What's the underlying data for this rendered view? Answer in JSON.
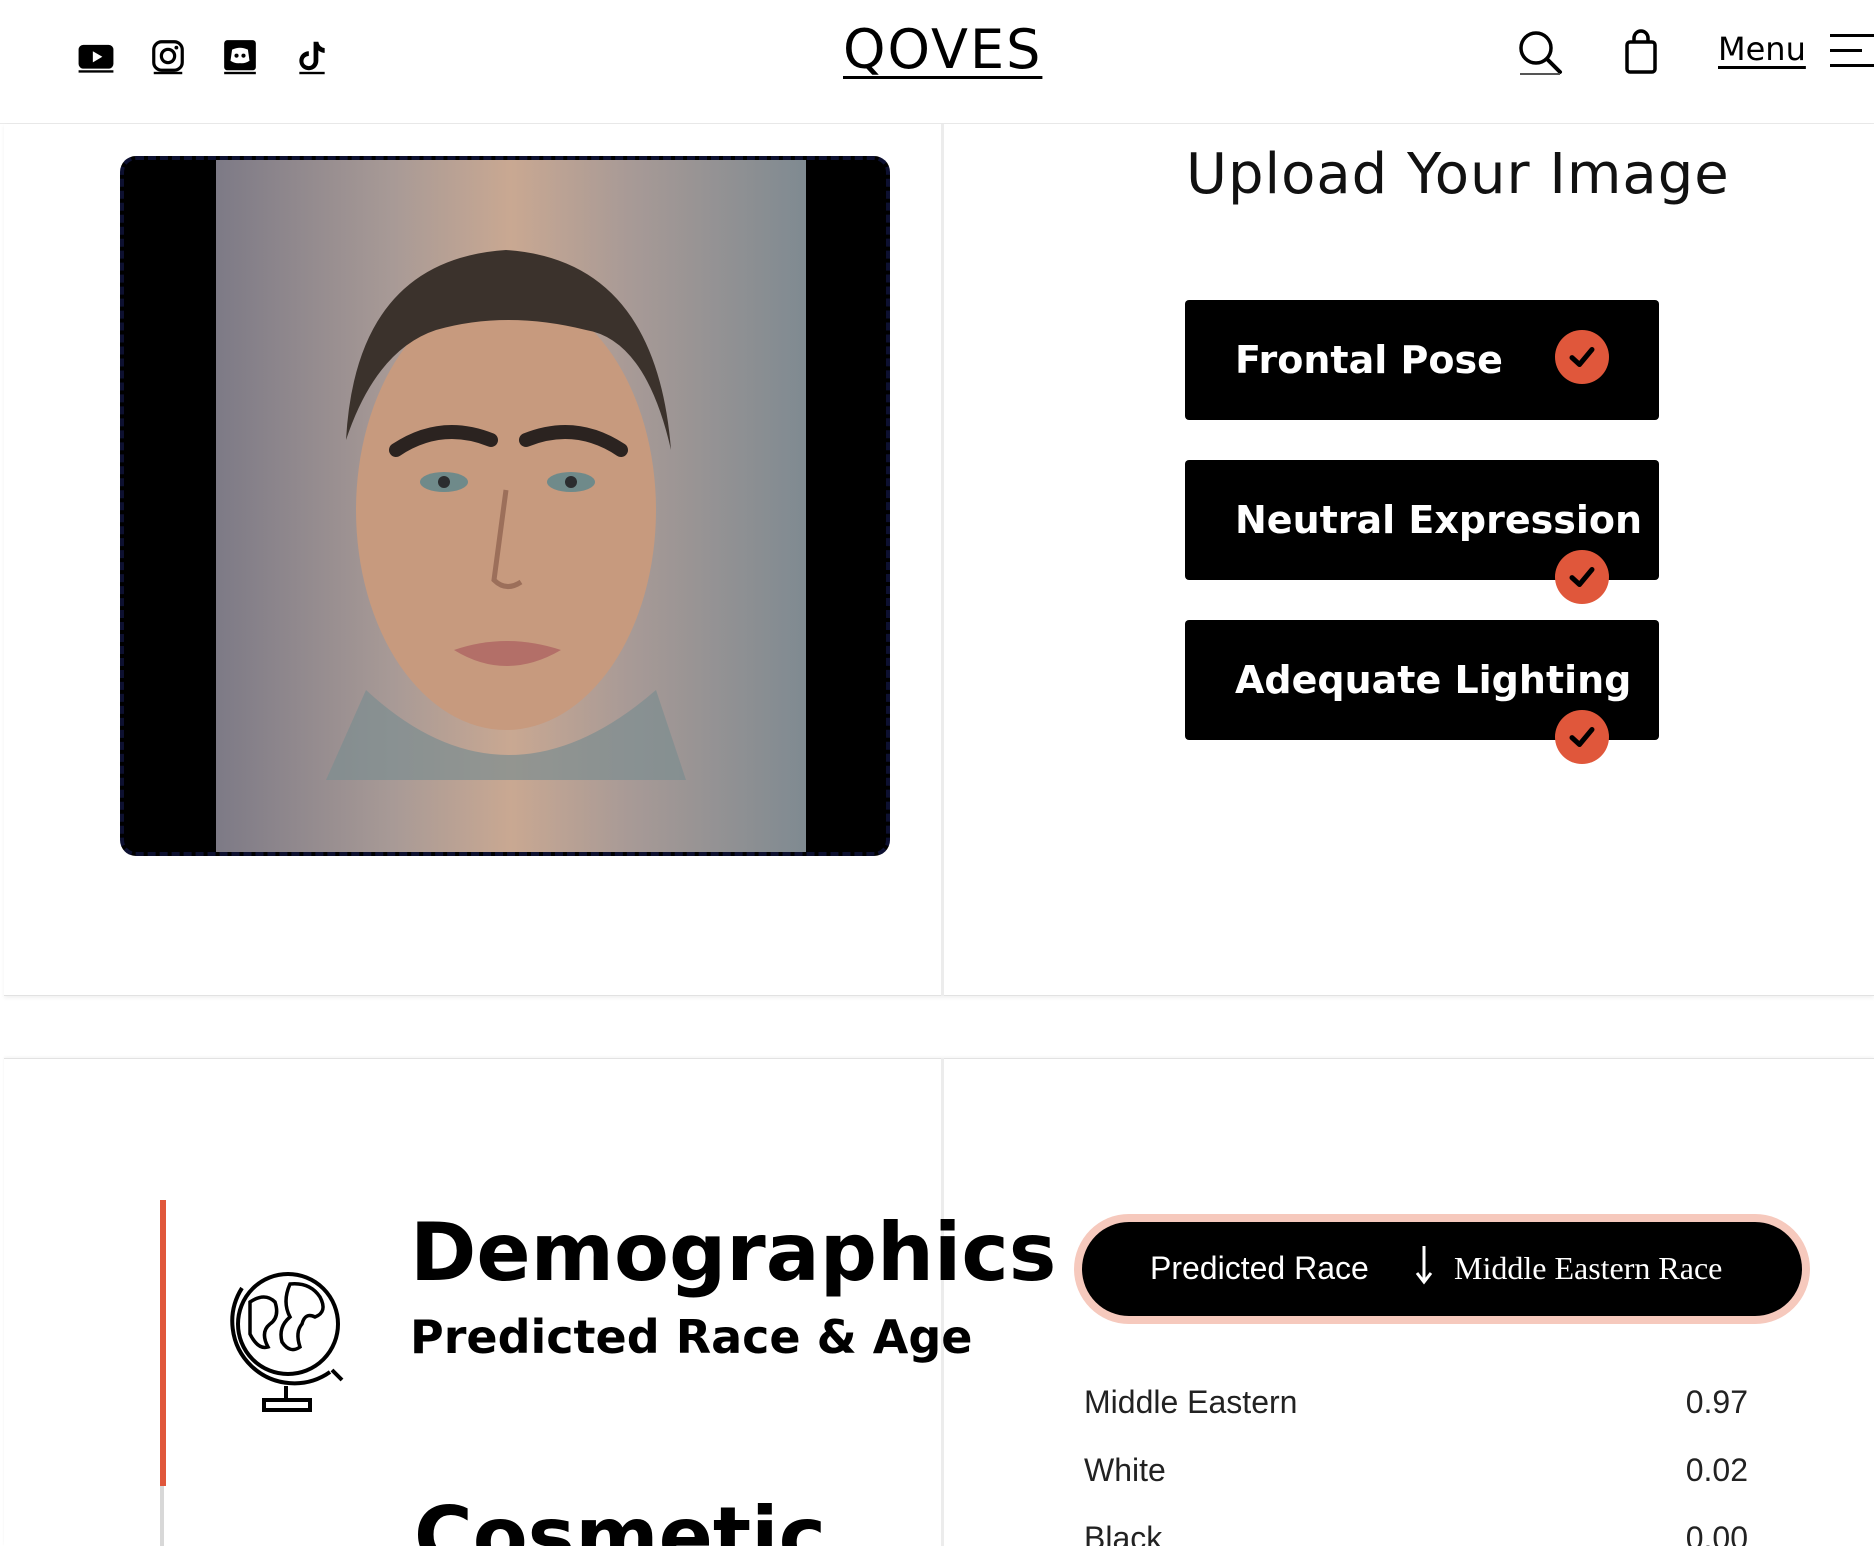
{
  "header": {
    "social_icons": [
      "youtube-icon",
      "instagram-icon",
      "discord-icon",
      "tiktok-icon"
    ],
    "logo": "QOVES",
    "menu_label": "Menu"
  },
  "upload": {
    "title": "Upload Your Image",
    "checks": [
      {
        "label": "Frontal Pose",
        "status": "passed"
      },
      {
        "label": "Neutral Expression",
        "status": "passed"
      },
      {
        "label": "Adequate Lighting",
        "status": "passed"
      }
    ]
  },
  "demographics": {
    "title": "Demographics",
    "subtitle": "Predicted Race & Age",
    "next_section_title": "Cosmetic",
    "predicted_race": {
      "label": "Predicted Race",
      "value": "Middle Eastern Race"
    },
    "race_scores": [
      {
        "race": "Middle Eastern",
        "score": "0.97"
      },
      {
        "race": "White",
        "score": "0.02"
      },
      {
        "race": "Black",
        "score": "0.00"
      }
    ]
  },
  "colors": {
    "accent": "#e0573b",
    "pill_border": "#f6c9bd",
    "frame_border": "#0d1030"
  }
}
